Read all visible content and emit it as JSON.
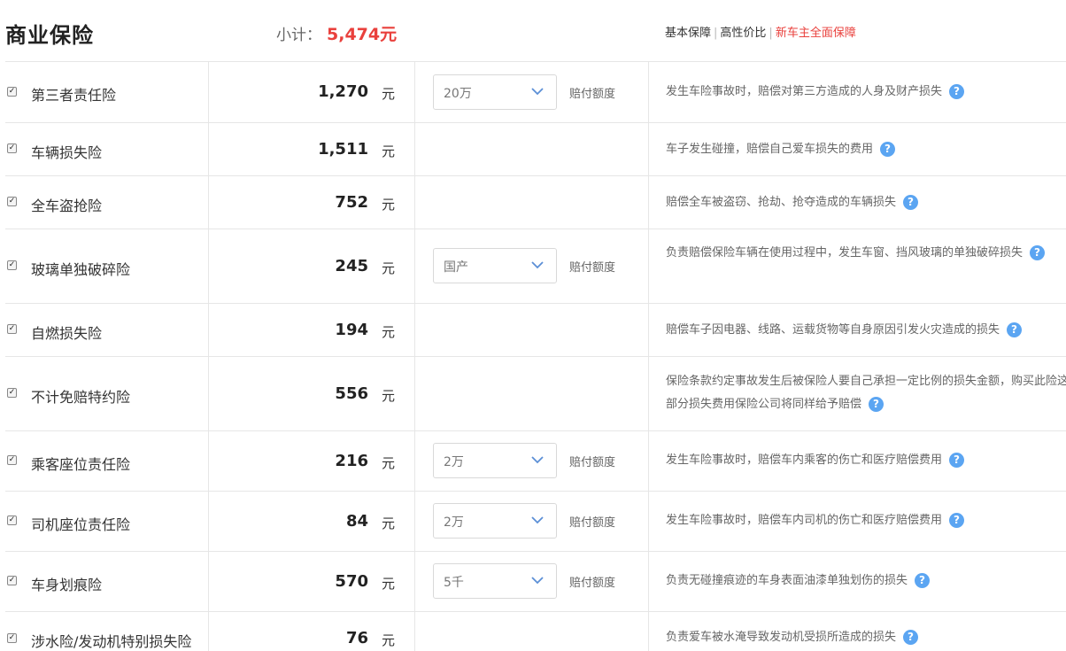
{
  "header": {
    "title": "商业保险",
    "subtotal_label": "小计：",
    "subtotal_value": "5,474元",
    "plans": [
      "基本保障",
      "高性价比",
      "新车主全面保障"
    ]
  },
  "colors": {
    "accent": "#e9403c",
    "help": "#5ba5f2"
  },
  "icons": {
    "checkbox": "checkbox-checked-icon",
    "help": "question-icon",
    "dropdown": "chevron-down-icon"
  },
  "rows": [
    {
      "name": "第三者责任险",
      "price": "1,270",
      "unit": "元",
      "select": "20万",
      "limit": "赔付额度",
      "desc": "发生车险事故时，赔偿对第三方造成的人身及财产损失"
    },
    {
      "name": "车辆损失险",
      "price": "1,511",
      "unit": "元",
      "desc": "车子发生碰撞，赔偿自己爱车损失的费用"
    },
    {
      "name": "全车盗抢险",
      "price": "752",
      "unit": "元",
      "desc": "赔偿全车被盗窃、抢劫、抢夺造成的车辆损失"
    },
    {
      "name": "玻璃单独破碎险",
      "price": "245",
      "unit": "元",
      "select": "国产",
      "limit": "赔付额度",
      "desc": "负责赔偿保险车辆在使用过程中，发生车窗、挡风玻璃的单独破碎损失"
    },
    {
      "name": "自燃损失险",
      "price": "194",
      "unit": "元",
      "desc": "赔偿车子因电器、线路、运载货物等自身原因引发火灾造成的损失"
    },
    {
      "name": "不计免赔特约险",
      "price": "556",
      "unit": "元",
      "desc": "保险条款约定事故发生后被保险人要自己承担一定比例的损失金额，购买此险这部分损失费用保险公司将同样给予赔偿"
    },
    {
      "name": "乘客座位责任险",
      "price": "216",
      "unit": "元",
      "select": "2万",
      "limit": "赔付额度",
      "desc": "发生车险事故时，赔偿车内乘客的伤亡和医疗赔偿费用"
    },
    {
      "name": "司机座位责任险",
      "price": "84",
      "unit": "元",
      "select": "2万",
      "limit": "赔付额度",
      "desc": "发生车险事故时，赔偿车内司机的伤亡和医疗赔偿费用"
    },
    {
      "name": "车身划痕险",
      "price": "570",
      "unit": "元",
      "select": "5千",
      "limit": "赔付额度",
      "desc": "负责无碰撞痕迹的车身表面油漆单独划伤的损失"
    },
    {
      "name": "涉水险/发动机特别损失险",
      "price": "76",
      "unit": "元",
      "desc": "负责爱车被水淹导致发动机受损所造成的损失"
    }
  ]
}
